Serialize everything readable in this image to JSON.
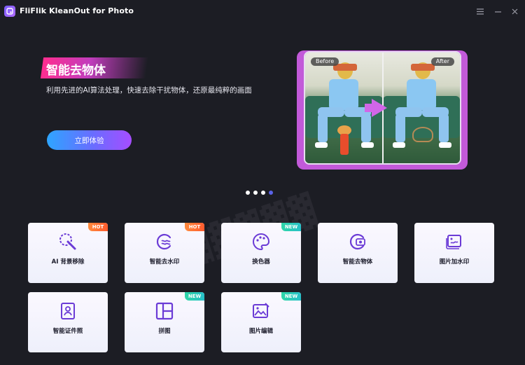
{
  "window": {
    "title": "FliFlik KleanOut for Photo",
    "controls": [
      "menu-icon",
      "minimize-icon",
      "close-icon"
    ]
  },
  "hero": {
    "title": "智能去物体",
    "description": "利用先进的AI算法处理，快速去除干扰物体，还原最纯粹的画面",
    "cta_label": "立即体验",
    "before_label": "Before",
    "after_label": "After"
  },
  "carousel": {
    "total": 4,
    "active_index": 3
  },
  "features": [
    {
      "label": "AI 背景移除",
      "badge": "HOT",
      "icon": "magic-brush-icon"
    },
    {
      "label": "智能去水印",
      "badge": "HOT",
      "icon": "watermark-remove-icon"
    },
    {
      "label": "换色器",
      "badge": "NEW",
      "icon": "palette-icon"
    },
    {
      "label": "智能去物体",
      "badge": "",
      "icon": "object-remove-icon"
    },
    {
      "label": "图片加水印",
      "badge": "",
      "icon": "add-watermark-icon"
    },
    {
      "label": "智能证件照",
      "badge": "",
      "icon": "id-photo-icon"
    },
    {
      "label": "拼图",
      "badge": "NEW",
      "icon": "collage-icon"
    },
    {
      "label": "图片编辑",
      "badge": "NEW",
      "icon": "image-edit-icon"
    }
  ],
  "colors": {
    "background": "#1c1d24",
    "accent_purple": "#7b3ff2",
    "hot_badge": "#ff6a33",
    "new_badge": "#2fd0b0"
  }
}
